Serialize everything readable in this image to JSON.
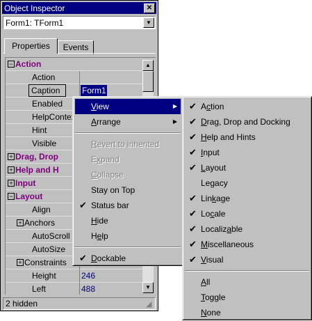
{
  "window": {
    "title": "Object Inspector",
    "close_glyph": "✕"
  },
  "component_combo": {
    "value": "Form1: TForm1",
    "arrow_icon": "chevron-down-icon"
  },
  "tabs": [
    {
      "label": "Properties",
      "active": true
    },
    {
      "label": "Events",
      "active": false
    }
  ],
  "grid_rows": [
    {
      "kind": "cat",
      "label": "Action",
      "expander": "⊟",
      "value": ""
    },
    {
      "kind": "prop",
      "label": "Action",
      "value": ""
    },
    {
      "kind": "sel",
      "label": "Caption",
      "value": "Form1"
    },
    {
      "kind": "prop",
      "label": "Enabled",
      "value": ""
    },
    {
      "kind": "prop",
      "label": "HelpContex",
      "value": ""
    },
    {
      "kind": "prop",
      "label": "Hint",
      "value": ""
    },
    {
      "kind": "prop",
      "label": "Visible",
      "value": ""
    },
    {
      "kind": "cat",
      "label": "Drag, Drop",
      "expander": "⊞",
      "value": ""
    },
    {
      "kind": "cat",
      "label": "Help and H",
      "expander": "⊞",
      "value": ""
    },
    {
      "kind": "cat",
      "label": "Input",
      "expander": "⊞",
      "value": ""
    },
    {
      "kind": "cat",
      "label": "Layout",
      "expander": "⊟",
      "value": ""
    },
    {
      "kind": "prop",
      "label": "Align",
      "value": ""
    },
    {
      "kind": "plus",
      "label": "Anchors",
      "expander": "⊞",
      "value": ""
    },
    {
      "kind": "prop",
      "label": "AutoScroll",
      "value": ""
    },
    {
      "kind": "prop",
      "label": "AutoSize",
      "value": ""
    },
    {
      "kind": "plus",
      "label": "Constraints",
      "expander": "⊞",
      "value": ""
    },
    {
      "kind": "prop",
      "label": "Height",
      "value": "246"
    },
    {
      "kind": "prop",
      "label": "Left",
      "value": "488"
    }
  ],
  "status": {
    "text": "2 hidden"
  },
  "context_menu": {
    "items": [
      {
        "label": "View",
        "mnemonic_index": 0,
        "state": "highlighted",
        "submenu": true
      },
      {
        "label": "Arrange",
        "mnemonic_index": 0,
        "state": "normal",
        "submenu": true
      },
      {
        "sep": true
      },
      {
        "label": "Revert to inherited",
        "mnemonic_index": 0,
        "state": "disabled"
      },
      {
        "label": "Expand",
        "mnemonic_index": 1,
        "state": "disabled"
      },
      {
        "label": "Collapse",
        "mnemonic_index": 0,
        "state": "disabled"
      },
      {
        "label": "Stay on Top",
        "mnemonic_index": -1,
        "state": "normal"
      },
      {
        "label": "Status bar",
        "mnemonic_index": -1,
        "state": "normal",
        "checked": true
      },
      {
        "label": "Hide",
        "mnemonic_index": 0,
        "state": "normal"
      },
      {
        "label": "Help",
        "mnemonic_index": 1,
        "state": "normal"
      },
      {
        "sep": true
      },
      {
        "label": "Dockable",
        "mnemonic_index": 0,
        "state": "normal",
        "checked": true
      }
    ]
  },
  "view_submenu": {
    "items": [
      {
        "label": "Action",
        "mnemonic_index": 1,
        "checked": true
      },
      {
        "label": "Drag, Drop and Docking",
        "mnemonic_index": 0,
        "checked": true
      },
      {
        "label": "Help and Hints",
        "mnemonic_index": 0,
        "checked": true
      },
      {
        "label": "Input",
        "mnemonic_index": 0,
        "checked": true
      },
      {
        "label": "Layout",
        "mnemonic_index": 0,
        "checked": true
      },
      {
        "label": "Legacy",
        "mnemonic_index": -1,
        "checked": false
      },
      {
        "label": "Linkage",
        "mnemonic_index": 3,
        "checked": true
      },
      {
        "label": "Locale",
        "mnemonic_index": 2,
        "checked": true
      },
      {
        "label": "Localizable",
        "mnemonic_index": 7,
        "checked": true
      },
      {
        "label": "Miscellaneous",
        "mnemonic_index": 0,
        "checked": true
      },
      {
        "label": "Visual",
        "mnemonic_index": 0,
        "checked": true
      },
      {
        "sep": true
      },
      {
        "label": "All",
        "mnemonic_index": 0,
        "checked": false
      },
      {
        "label": "Toggle",
        "mnemonic_index": 0,
        "checked": false
      },
      {
        "label": "None",
        "mnemonic_index": 0,
        "checked": false
      }
    ]
  },
  "icons": {
    "check": "✔",
    "submenu_arrow": "▶",
    "scroll_up": "▲",
    "scroll_down": "▼",
    "grip": "◢"
  }
}
